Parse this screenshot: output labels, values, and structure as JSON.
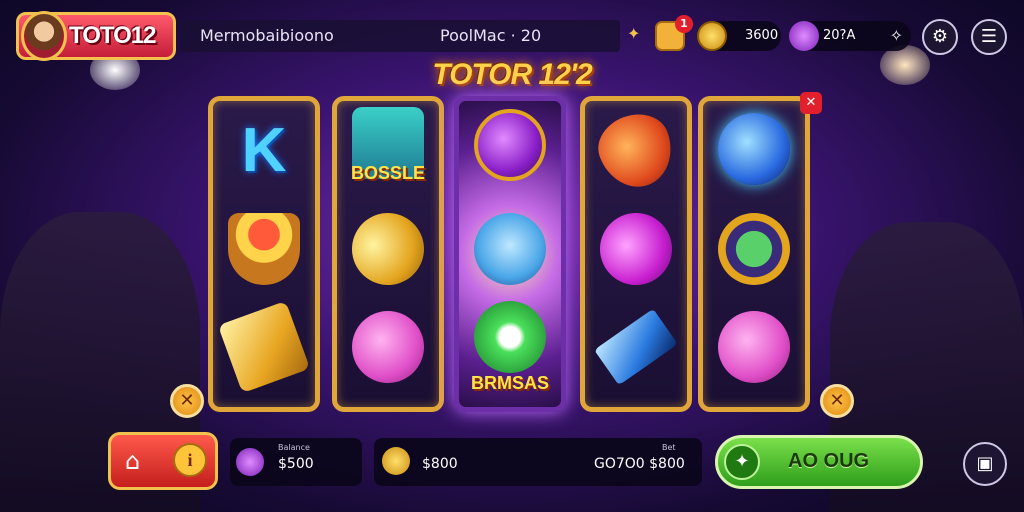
{
  "header": {
    "logo_text": "TOTO12",
    "game_name": "Mermobaibioono",
    "pool": "PoolMac · 20",
    "notification_count": "1",
    "coin_balance": "3600",
    "gem_balance": "20?A",
    "settings_icon": "gear-icon",
    "menu_icon": "hamburger-icon"
  },
  "reels_title": "TOTOR 12'2",
  "reels": [
    {
      "symbols": [
        "k-letter",
        "fruit-basket",
        "gold-bar"
      ],
      "label": "K"
    },
    {
      "symbols": [
        "bonus-chest",
        "gold-egg",
        "pink-pig"
      ],
      "label": "BOSSLE"
    },
    {
      "symbols": [
        "purple-orb",
        "blue-cat",
        "green-jester"
      ],
      "label": "BRMSAS",
      "active": true
    },
    {
      "symbols": [
        "red-gem",
        "purple-gem",
        "blue-crystal"
      ]
    },
    {
      "symbols": [
        "blue-orb",
        "green-ring",
        "pink-pig"
      ]
    }
  ],
  "footer": {
    "balance_caption": "Balance",
    "balance_value": "$500",
    "bet_caption": "Bet",
    "bet_value": "$800",
    "win_value": "GO7O0 $800",
    "spin_label": "AO OUG"
  },
  "colors": {
    "accent": "#f2c14e",
    "spin": "#3fb82a",
    "home": "#d62b22"
  }
}
